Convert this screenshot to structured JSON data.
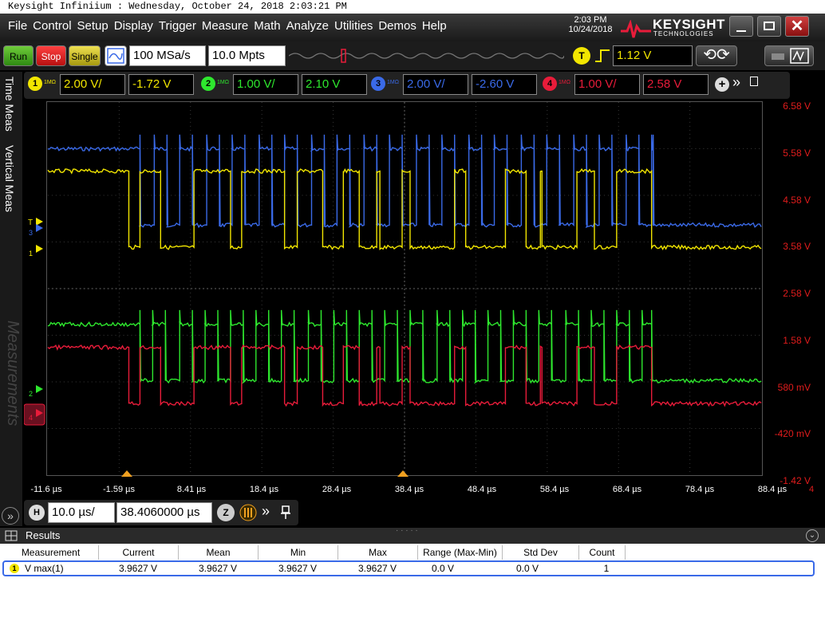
{
  "window_title": "Keysight Infiniium : Wednesday, October 24, 2018 2:03:21 PM",
  "menu": [
    "File",
    "Control",
    "Setup",
    "Display",
    "Trigger",
    "Measure",
    "Math",
    "Analyze",
    "Utilities",
    "Demos",
    "Help"
  ],
  "clock": {
    "time": "2:03 PM",
    "date": "10/24/2018"
  },
  "logo": {
    "brand": "KEYSIGHT",
    "sub": "TECHNOLOGIES"
  },
  "toolbar": {
    "run": "Run",
    "stop": "Stop",
    "single": "Single",
    "sample_rate": "100 MSa/s",
    "memory": "10.0 Mpts",
    "trigger_label": "T",
    "trigger_level": "1.12 V"
  },
  "channels": [
    {
      "num": "1",
      "imp": "1MΩ",
      "scale": "2.00 V/",
      "offset": "-1.72 V",
      "color": "#f2e600"
    },
    {
      "num": "2",
      "imp": "1MΩ",
      "scale": "1.00 V/",
      "offset": "2.10 V",
      "color": "#2ee82e"
    },
    {
      "num": "3",
      "imp": "1MΩ",
      "scale": "2.00 V/",
      "offset": "-2.60 V",
      "color": "#3a6ae8"
    },
    {
      "num": "4",
      "imp": "1MΩ",
      "scale": "1.00 V/",
      "offset": "2.58 V",
      "color": "#e81c3a"
    }
  ],
  "side_tabs": {
    "time": "Time Meas",
    "vertical": "Vertical Meas",
    "ghost": "Measurements"
  },
  "y_labels": [
    "6.58 V",
    "5.58 V",
    "4.58 V",
    "3.58 V",
    "2.58 V",
    "1.58 V",
    "580 mV",
    "-420 mV",
    "-1.42 V"
  ],
  "x_labels": [
    "-11.6 µs",
    "-1.59 µs",
    "8.41 µs",
    "18.4 µs",
    "28.4 µs",
    "38.4 µs",
    "48.4 µs",
    "58.4 µs",
    "68.4 µs",
    "78.4 µs",
    "88.4 µs"
  ],
  "x_label_extra": "4",
  "horizontal": {
    "label": "H",
    "scale": "10.0 µs/",
    "position": "38.4060000 µs"
  },
  "results": {
    "title": "Results",
    "headers": [
      "Measurement",
      "Current",
      "Mean",
      "Min",
      "Max",
      "Range (Max-Min)",
      "Std Dev",
      "Count"
    ],
    "row": {
      "badge": "1",
      "name": "V max(1)",
      "current": "3.9627 V",
      "mean": "3.9627 V",
      "min": "3.9627 V",
      "max": "3.9627 V",
      "range": "0.0 V",
      "std": "0.0 V",
      "count": "1"
    }
  },
  "colors": {
    "scale_labels": "#e01c1c",
    "grid": "#3a3a3a"
  }
}
